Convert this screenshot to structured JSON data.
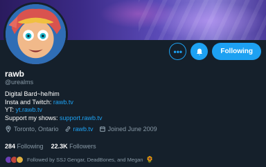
{
  "profile": {
    "name": "rawb",
    "handle": "@urealms",
    "bio": {
      "line1": "Digital Bard~he/him",
      "line2_prefix": "Insta and Twitch: ",
      "line2_link": "rawb.tv",
      "line3_prefix": "YT: ",
      "line3_link": "yt.rawb.tv",
      "line4_prefix": "Support my shows: ",
      "line4_link": "support.rawb.tv"
    },
    "location": "Toronto, Ontario",
    "website": "rawb.tv",
    "joined": "Joined June 2009"
  },
  "stats": {
    "following_count": "284",
    "following_label": "Following",
    "followers_count": "22.3K",
    "followers_label": "Followers"
  },
  "actions": {
    "more_icon": "more-icon",
    "notify_icon": "bell-icon",
    "follow_label": "Following"
  },
  "followed_by": {
    "text": "Followed by SSJ Gengar, DeadBones, and Megan",
    "emoji": "🌻"
  },
  "colors": {
    "background": "#15202b",
    "accent": "#1da1f2",
    "secondary_text": "#8899a6"
  }
}
